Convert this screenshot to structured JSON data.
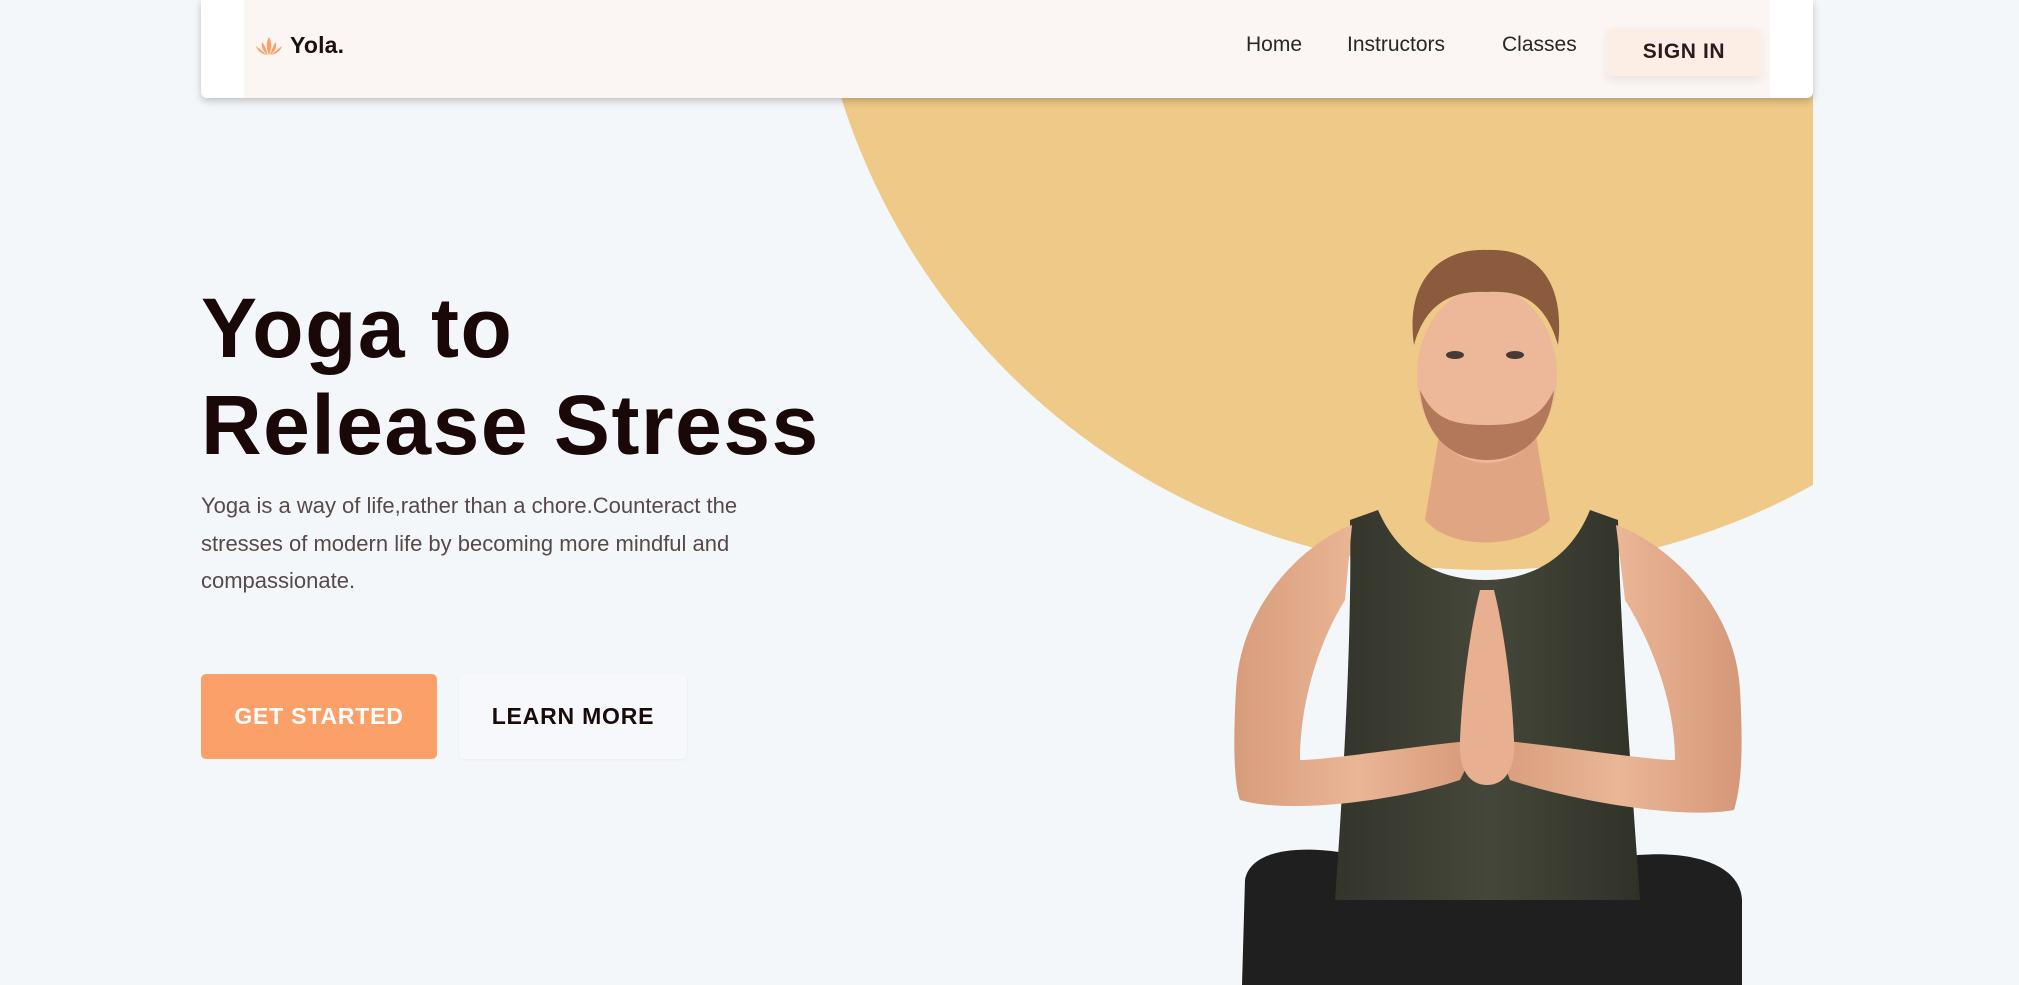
{
  "brand": {
    "name": "Yola.",
    "logo_icon": "lotus-icon"
  },
  "nav": {
    "links": [
      "Home",
      "Instructors",
      "Classes"
    ],
    "signin_label": "SIGN IN"
  },
  "hero": {
    "title_line1": "Yoga to",
    "title_line2": "Release Stress",
    "description": "Yoga is a way of life,rather than a chore.Counteract the stresses of modern life by becoming more mindful and compassionate.",
    "primary_cta": "GET STARTED",
    "secondary_cta": "LEARN MORE"
  },
  "colors": {
    "background": "#f4f7fa",
    "accent": "#fca06a",
    "circle": "#eec987",
    "title": "#1a0808"
  }
}
